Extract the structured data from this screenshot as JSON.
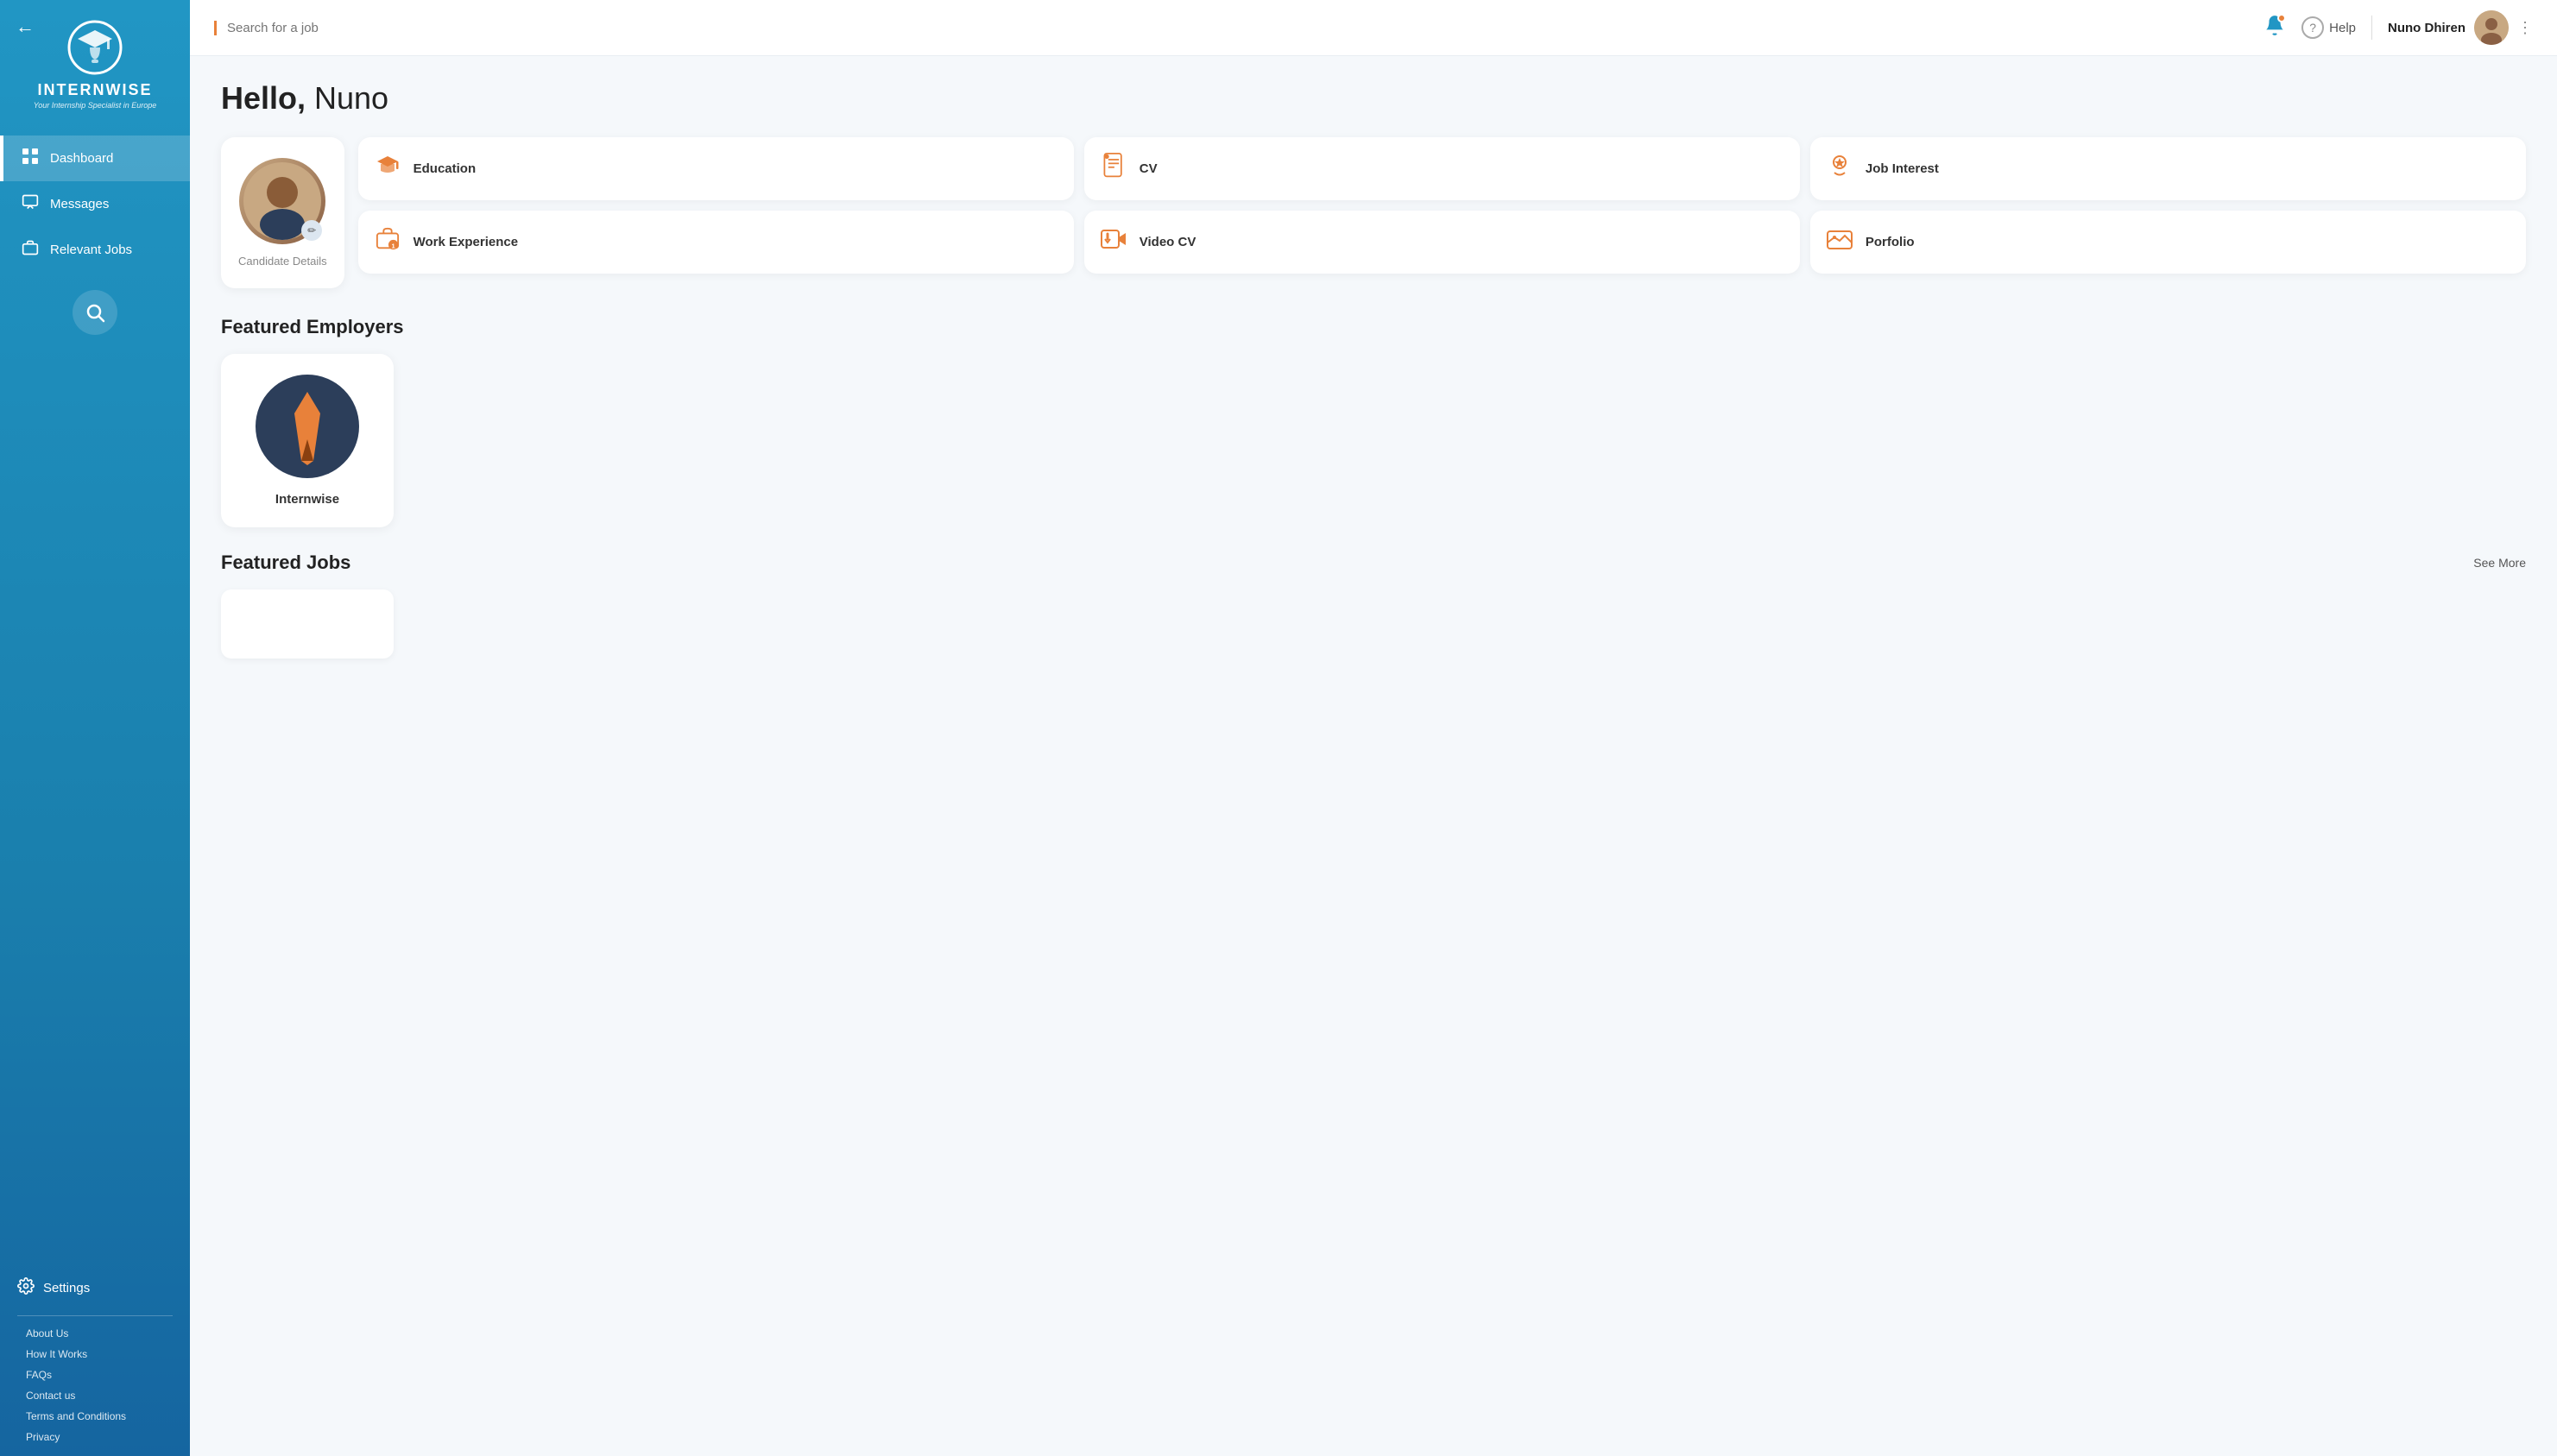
{
  "sidebar": {
    "back_label": "←",
    "logo_text": "INTERNWISE",
    "logo_sub": "Your Internship Specialist in Europe",
    "nav_items": [
      {
        "id": "dashboard",
        "label": "Dashboard",
        "icon": "⊞",
        "active": true
      },
      {
        "id": "messages",
        "label": "Messages",
        "icon": "🗂"
      },
      {
        "id": "relevant-jobs",
        "label": "Relevant Jobs",
        "icon": "💼"
      }
    ],
    "settings_label": "Settings",
    "links": [
      "About Us",
      "How It Works",
      "FAQs",
      "Contact us",
      "Terms and Conditions",
      "Privacy"
    ]
  },
  "header": {
    "search_placeholder": "Search for a job",
    "help_label": "Help",
    "user_name": "Nuno Dhiren",
    "notification_count": 1
  },
  "greeting": {
    "bold_part": "Hello,",
    "name_part": " Nuno"
  },
  "profile_card": {
    "label": "Candidate Details"
  },
  "feature_cards": [
    {
      "id": "education",
      "label": "Education",
      "icon": "🎓"
    },
    {
      "id": "cv",
      "label": "CV",
      "icon": "📄"
    },
    {
      "id": "job-interest",
      "label": "Job Interest",
      "icon": "❤"
    },
    {
      "id": "work-experience",
      "label": "Work Experience",
      "icon": "🏅"
    },
    {
      "id": "video-cv",
      "label": "Video CV",
      "icon": "⬆"
    },
    {
      "id": "portfolio",
      "label": "Porfolio",
      "icon": "🖼"
    }
  ],
  "featured_employers": {
    "title": "Featured Employers",
    "employers": [
      {
        "id": "internwise",
        "name": "Internwise"
      }
    ]
  },
  "featured_jobs": {
    "title": "Featured Jobs",
    "see_more_label": "See More"
  }
}
